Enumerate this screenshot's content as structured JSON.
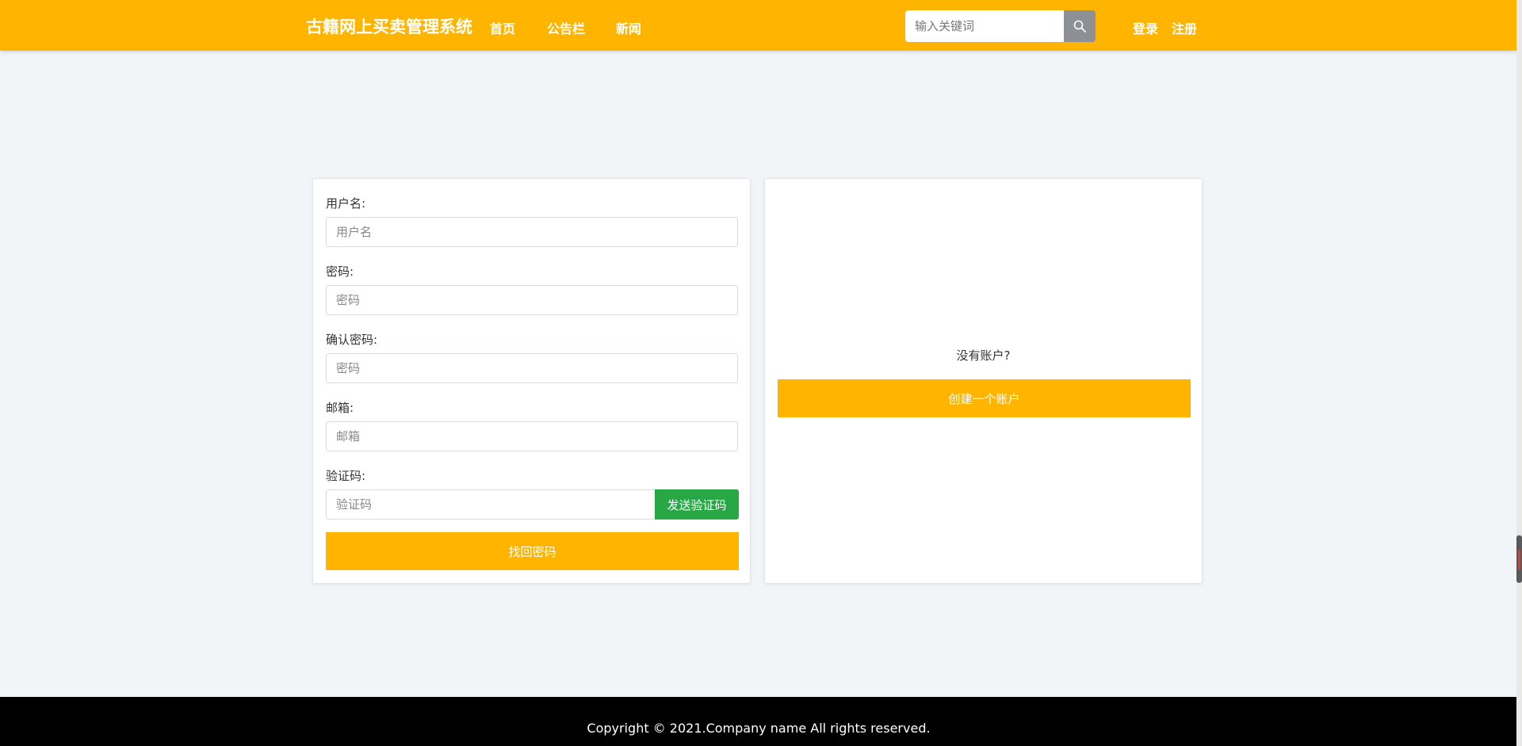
{
  "header": {
    "brand": "古籍网上买卖管理系统",
    "nav": [
      "首页",
      "公告栏",
      "新闻"
    ],
    "search": {
      "placeholder": "输入关键词",
      "icon": "search-icon"
    },
    "auth": {
      "login": "登录",
      "register": "注册"
    }
  },
  "form": {
    "username": {
      "label": "用户名:",
      "placeholder": "用户名"
    },
    "password": {
      "label": "密码:",
      "placeholder": "密码"
    },
    "confirm_password": {
      "label": "确认密码:",
      "placeholder": "密码"
    },
    "email": {
      "label": "邮箱:",
      "placeholder": "邮箱"
    },
    "code": {
      "label": "验证码:",
      "placeholder": "验证码",
      "send_button": "发送验证码"
    },
    "submit": "找回密码"
  },
  "side": {
    "no_account": "没有账户?",
    "create_button": "创建一个账户"
  },
  "footer": {
    "copyright": "Copyright © 2021.Company name All rights reserved."
  },
  "colors": {
    "primary": "#ffb400",
    "success": "#28a745",
    "background": "#f2f5f8",
    "footer": "#000000"
  }
}
